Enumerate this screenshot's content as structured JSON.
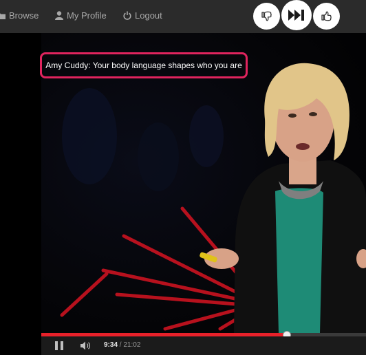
{
  "nav": {
    "browse": "Browse",
    "profile": "My Profile",
    "logout": "Logout"
  },
  "vote": {
    "dislike_icon": "thumbs-down-icon",
    "skip_icon": "fast-forward-icon",
    "like_icon": "thumbs-up-icon"
  },
  "video": {
    "title": "Amy Cuddy: Your body language shapes who you are",
    "current_time": "9:34",
    "separator": "/",
    "duration": "21:02",
    "progress_fraction": 0.755
  },
  "colors": {
    "accent": "#e0245e",
    "progress": "#e8212a",
    "topbar": "#2b2b2b"
  }
}
